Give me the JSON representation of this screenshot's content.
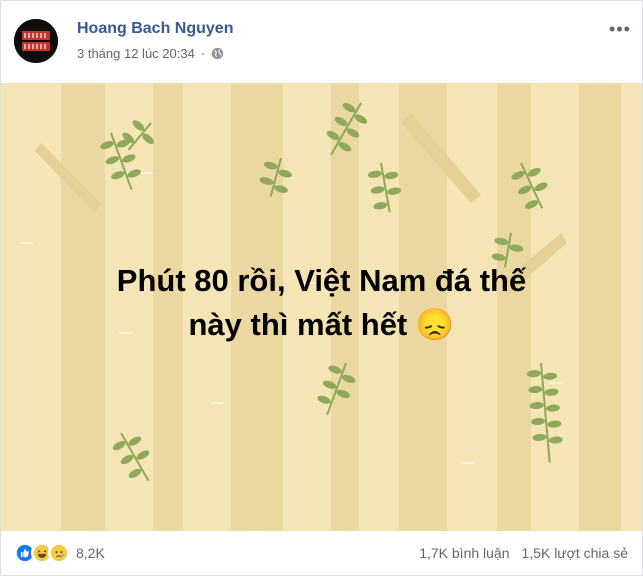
{
  "post": {
    "author": "Hoang Bach Nguyen",
    "timestamp": "3 tháng 12 lúc 20:34",
    "privacy_icon": "globe-icon",
    "avatar_text_top": "Sim",
    "avatar_text_bottom": "ms",
    "text_line1": "Phút 80 rồi, Việt Nam đá thế",
    "text_line2": "này thì mất hết",
    "emoji": "😞",
    "background_color": "#f4e4b6"
  },
  "footer": {
    "reaction_icons": [
      "like-icon",
      "haha-icon",
      "sad-icon"
    ],
    "reaction_count": "8,2K",
    "comments": "1,7K bình luận",
    "shares": "1,5K lượt chia sẻ"
  },
  "colors": {
    "author_link": "#385898",
    "muted": "#616770",
    "leaf": "#8ea957",
    "tree": "#e8d49f"
  }
}
